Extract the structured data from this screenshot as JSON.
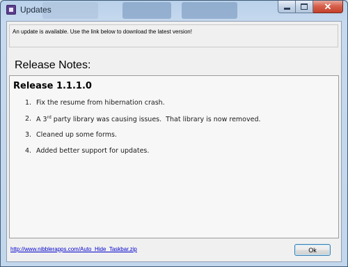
{
  "window": {
    "title": "Updates"
  },
  "message": {
    "text": "An update is available.  Use the link below to download the latest version!"
  },
  "release_notes": {
    "heading": "Release Notes:",
    "release_title": "Release 1.1.1.0",
    "items": [
      {
        "num": "1.",
        "text": "Fix the resume from hibernation crash."
      },
      {
        "num": "2.",
        "text_before": "A 3",
        "superscript": "rd",
        "text_after": " party library was causing issues.  That library is now removed."
      },
      {
        "num": "3.",
        "text": "Cleaned up some forms."
      },
      {
        "num": "4.",
        "text": "Added better support for updates."
      }
    ]
  },
  "footer": {
    "link_text": "http://www.nibblerapps.com/Auto_Hide_Taskbar.zip",
    "ok_label": "Ok"
  },
  "icons": {
    "app": "app-icon",
    "minimize": "minimize-icon",
    "maximize": "maximize-icon",
    "close": "close-icon"
  },
  "colors": {
    "close_button": "#c4412b",
    "link": "#0000cc",
    "frame": "#b9d1ea"
  }
}
